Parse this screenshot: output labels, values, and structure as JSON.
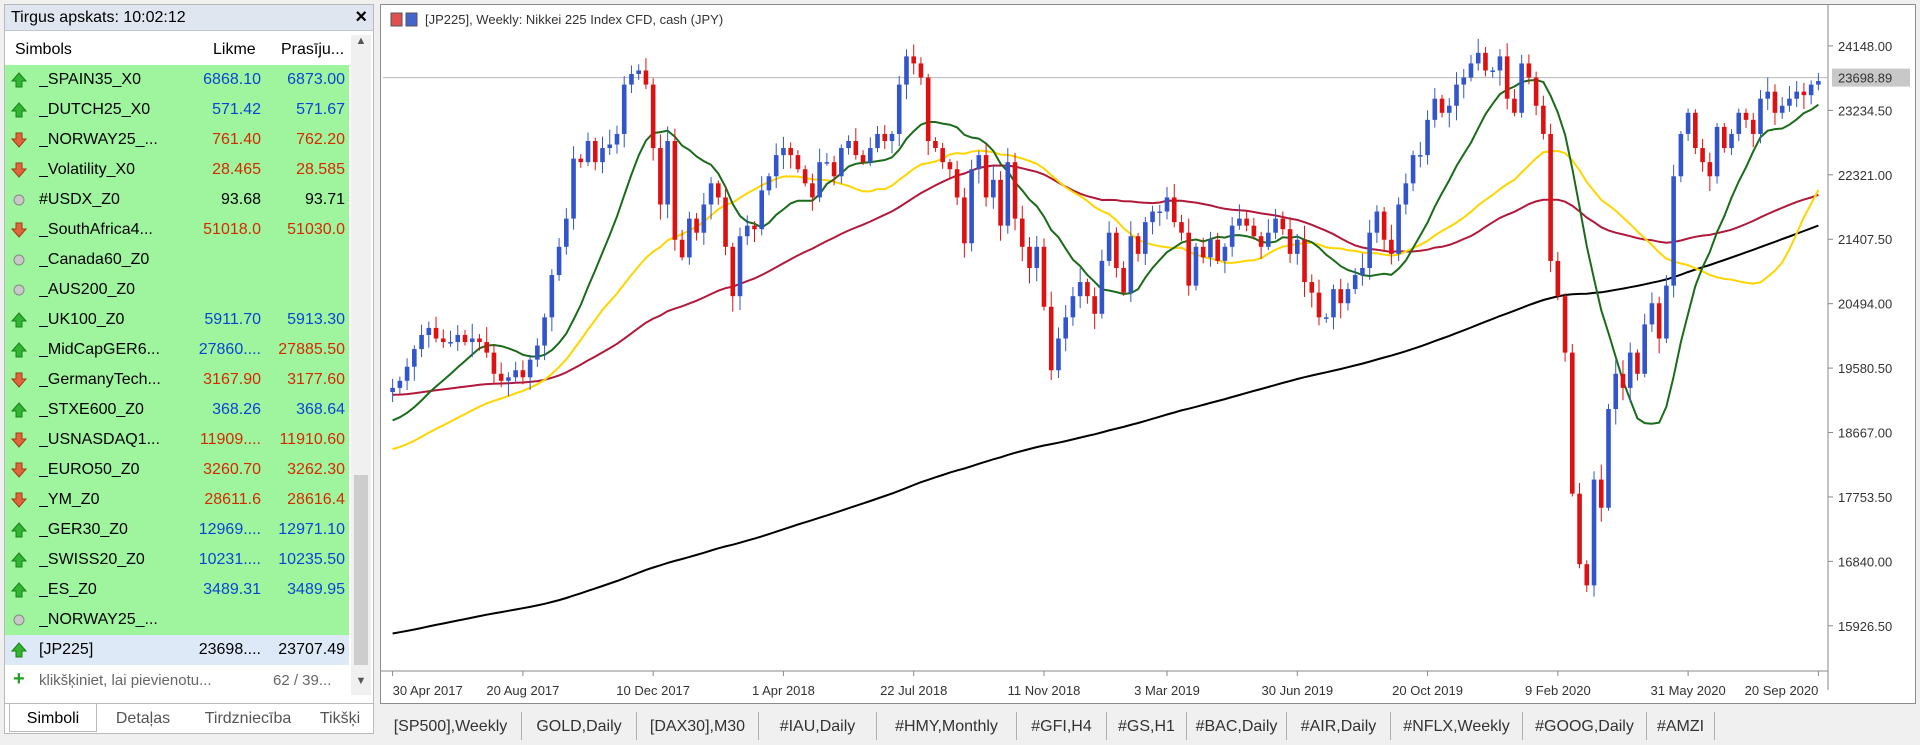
{
  "market_watch": {
    "title": "Tirgus apskats: 10:02:12",
    "close_glyph": "×",
    "columns": {
      "symbol": "Simbols",
      "bid": "Likme",
      "ask": "Prasīju..."
    },
    "rows": [
      {
        "symbol": "_SPAIN35_X0",
        "bid": "6868.10",
        "ask": "6873.00",
        "dir": "up",
        "color": "up"
      },
      {
        "symbol": "_DUTCH25_X0",
        "bid": "571.42",
        "ask": "571.67",
        "dir": "up",
        "color": "up"
      },
      {
        "symbol": "_NORWAY25_...",
        "bid": "761.40",
        "ask": "762.20",
        "dir": "down",
        "color": "dn"
      },
      {
        "symbol": "_Volatility_X0",
        "bid": "28.465",
        "ask": "28.585",
        "dir": "down",
        "color": "dn"
      },
      {
        "symbol": "#USDX_Z0",
        "bid": "93.68",
        "ask": "93.71",
        "dir": "none",
        "color": "nt"
      },
      {
        "symbol": "_SouthAfrica4...",
        "bid": "51018.0",
        "ask": "51030.0",
        "dir": "down",
        "color": "dn"
      },
      {
        "symbol": "_Canada60_Z0",
        "bid": "",
        "ask": "",
        "dir": "none",
        "color": "nt"
      },
      {
        "symbol": "_AUS200_Z0",
        "bid": "",
        "ask": "",
        "dir": "none",
        "color": "nt"
      },
      {
        "symbol": "_UK100_Z0",
        "bid": "5911.70",
        "ask": "5913.30",
        "dir": "up",
        "color": "up"
      },
      {
        "symbol": "_MidCapGER6...",
        "bid": "27860....",
        "ask": "27885.50",
        "dir": "up",
        "color": "mix"
      },
      {
        "symbol": "_GermanyTech...",
        "bid": "3167.90",
        "ask": "3177.60",
        "dir": "down",
        "color": "dn"
      },
      {
        "symbol": "_STXE600_Z0",
        "bid": "368.26",
        "ask": "368.64",
        "dir": "up",
        "color": "up"
      },
      {
        "symbol": "_USNASDAQ1...",
        "bid": "11909....",
        "ask": "11910.60",
        "dir": "down",
        "color": "dn"
      },
      {
        "symbol": "_EURO50_Z0",
        "bid": "3260.70",
        "ask": "3262.30",
        "dir": "down",
        "color": "dn"
      },
      {
        "symbol": "_YM_Z0",
        "bid": "28611.6",
        "ask": "28616.4",
        "dir": "down",
        "color": "dn"
      },
      {
        "symbol": "_GER30_Z0",
        "bid": "12969....",
        "ask": "12971.10",
        "dir": "up",
        "color": "up"
      },
      {
        "symbol": "_SWISS20_Z0",
        "bid": "10231....",
        "ask": "10235.50",
        "dir": "up",
        "color": "up"
      },
      {
        "symbol": "_ES_Z0",
        "bid": "3489.31",
        "ask": "3489.95",
        "dir": "up",
        "color": "up"
      },
      {
        "symbol": "_NORWAY25_...",
        "bid": "",
        "ask": "",
        "dir": "none",
        "color": "nt"
      },
      {
        "symbol": "[JP225]",
        "bid": "23698....",
        "ask": "23707.49",
        "dir": "up",
        "color": "nt",
        "selected": true
      }
    ],
    "add_hint": "klikšķiniet, lai pievienotu...",
    "count": "62 / 39...",
    "tabs": [
      "Simboli",
      "Detaļas",
      "Tirdzniecība",
      "Tikšķi"
    ],
    "active_tab": 0
  },
  "chart_window": {
    "title": "[JP225], Weekly:  Nikkei 225 Index CFD, cash (JPY)",
    "current_price_label": "23698.89",
    "colors": {
      "bull": "#3355cc",
      "bear": "#dd1111",
      "ma_fast": "#1a6b1a",
      "ma_mid": "#ffd500",
      "ma_slow": "#b0193a",
      "ma_long": "#000000"
    }
  },
  "chart_data": {
    "type": "candlestick",
    "title": "[JP225], Weekly:  Nikkei 225 Index CFD, cash (JPY)",
    "x_ticks": [
      "30 Apr 2017",
      "20 Aug 2017",
      "10 Dec 2017",
      "1 Apr 2018",
      "22 Jul 2018",
      "11 Nov 2018",
      "3 Mar 2019",
      "30 Jun 2019",
      "20 Oct 2019",
      "9 Feb 2020",
      "31 May 2020",
      "20 Sep 2020"
    ],
    "y_ticks": [
      "24148.00",
      "23234.50",
      "22321.00",
      "21407.50",
      "20494.00",
      "19580.50",
      "18667.00",
      "17753.50",
      "16840.00",
      "15926.50"
    ],
    "ylim": [
      15300,
      24700
    ],
    "last_price": 23698.89,
    "close_series": [
      19300,
      19400,
      19600,
      19850,
      20050,
      20150,
      20000,
      19950,
      19950,
      20050,
      19950,
      20000,
      19950,
      19800,
      19500,
      19400,
      19450,
      19550,
      19450,
      19700,
      19900,
      20300,
      20900,
      21300,
      21700,
      22550,
      22500,
      22800,
      22500,
      22700,
      22750,
      22900,
      23600,
      23750,
      23800,
      23600,
      22700,
      21900,
      22800,
      21400,
      21150,
      21700,
      21500,
      21900,
      22200,
      22000,
      21300,
      20600,
      21450,
      21600,
      21550,
      22100,
      22300,
      22600,
      22700,
      22600,
      22400,
      22200,
      22000,
      22500,
      22500,
      22300,
      22700,
      22800,
      22600,
      22500,
      22700,
      22900,
      22800,
      22900,
      23600,
      24000,
      23900,
      23700,
      22800,
      22700,
      22500,
      22400,
      22000,
      21350,
      22400,
      22600,
      22000,
      22250,
      21600,
      22500,
      21700,
      21300,
      21000,
      21300,
      20450,
      19550,
      20000,
      20300,
      20600,
      20800,
      20600,
      20350,
      21100,
      21500,
      21000,
      20650,
      21450,
      21200,
      21650,
      21800,
      21800,
      22000,
      21650,
      21500,
      20750,
      21300,
      21150,
      21400,
      21100,
      21300,
      21600,
      21700,
      21600,
      21450,
      21300,
      21500,
      21700,
      21550,
      21200,
      21400,
      20800,
      20650,
      20300,
      20300,
      20700,
      20500,
      20700,
      20900,
      21000,
      21500,
      21800,
      21400,
      21200,
      21900,
      22200,
      22600,
      22600,
      23100,
      23400,
      23200,
      23300,
      23600,
      23700,
      23900,
      24050,
      23800,
      23800,
      24000,
      23400,
      23200,
      23900,
      23700,
      23300,
      22900,
      21100,
      20600,
      19800,
      17800,
      16800,
      16500,
      18000,
      17600,
      19000,
      19500,
      19300,
      19800,
      19500,
      20200,
      20500,
      20000,
      20750,
      22300,
      22900,
      23200,
      22700,
      22500,
      22300,
      23000,
      22700,
      22900,
      23200,
      23100,
      22900,
      23400,
      23500,
      23200,
      23300,
      23400,
      23500,
      23450,
      23600,
      23650
    ]
  }
}
